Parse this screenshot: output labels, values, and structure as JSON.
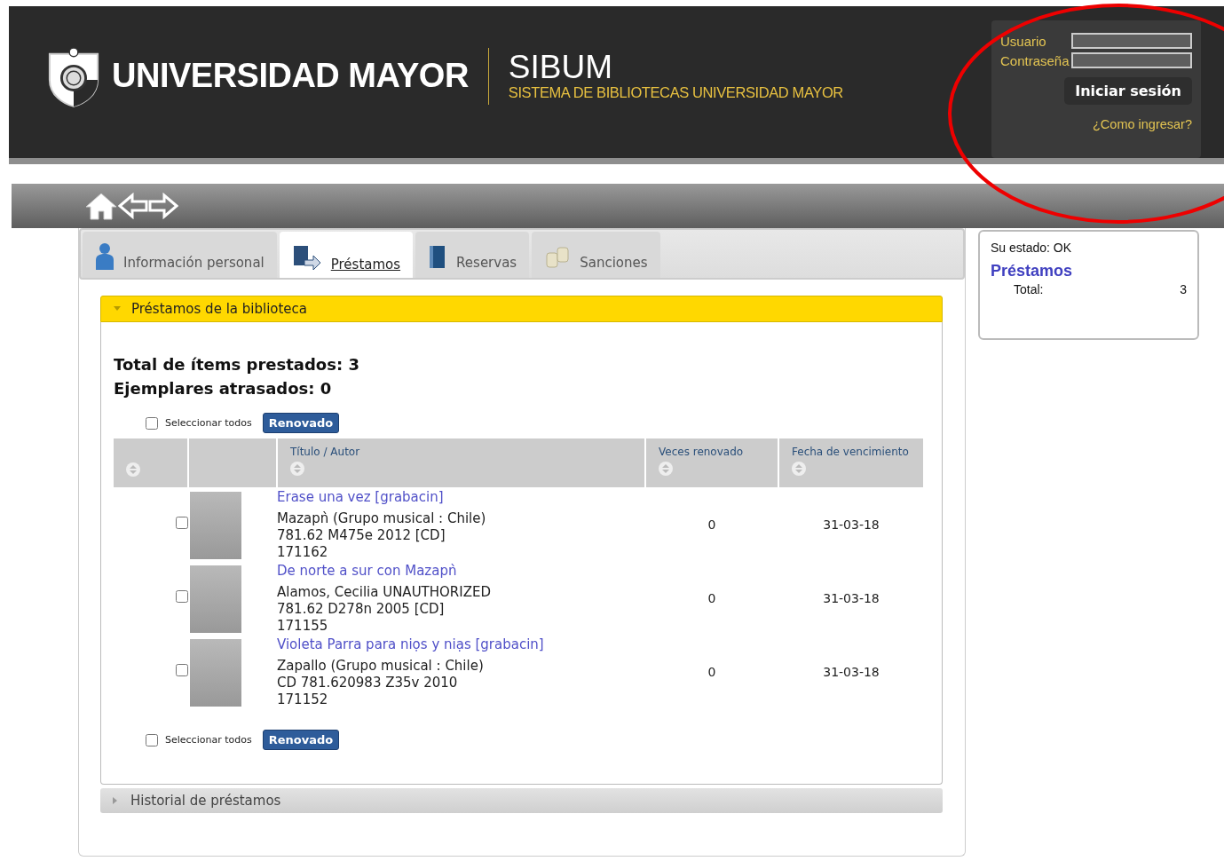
{
  "header": {
    "brand": "UNIVERSIDAD MAYOR",
    "app_title": "SIBUM",
    "app_subtitle": "SISTEMA DE BIBLIOTECAS UNIVERSIDAD MAYOR"
  },
  "login": {
    "user_label": "Usuario",
    "password_label": "Contraseña",
    "button": "Iniciar sesión",
    "help_link": "¿Como ingresar?"
  },
  "tabs": [
    {
      "label": "Información personal",
      "kind": "person",
      "selected": false
    },
    {
      "label": "Préstamos",
      "kind": "loan",
      "selected": true
    },
    {
      "label": "Reservas",
      "kind": "book",
      "selected": false
    },
    {
      "label": "Sanciones",
      "kind": "coins",
      "selected": false
    }
  ],
  "loans_section": {
    "title": "Préstamos de la biblioteca",
    "expanded": true,
    "total": "Total de ítems prestados: 3",
    "overdue": "Ejemplares atrasados: 0",
    "select_all": "Seleccionar todos",
    "select_all_checked": false,
    "renew_button": "Renovado"
  },
  "table": {
    "columns": [
      "Título / Autor",
      "Veces renovado",
      "Fecha de vencimiento"
    ],
    "rows": [
      {
        "checked": false,
        "title": "Erase una vez [grabacin]",
        "author": "Mazapǹ (Grupo musical : Chile)",
        "call_number": "781.62 M475e 2012 [CD]",
        "barcode": "171162",
        "renewals": "0",
        "due": "31-03-18"
      },
      {
        "checked": false,
        "title": "De norte a sur con Mazapǹ",
        "author": "Alamos, Cecilia UNAUTHORIZED",
        "call_number": "781.62 D278n 2005 [CD]",
        "barcode": "171155",
        "renewals": "0",
        "due": "31-03-18"
      },
      {
        "checked": false,
        "title": "Violeta Parra para niọs y niạs [grabacin]",
        "author": "Zapallo (Grupo musical : Chile)",
        "call_number": "CD 781.620983 Z35v 2010",
        "barcode": "171152",
        "renewals": "0",
        "due": "31-03-18"
      }
    ]
  },
  "bottom_actions": {
    "select_all": "Seleccionar todos",
    "select_all_checked": false,
    "renew_button": "Renovado"
  },
  "history_section": {
    "title": "Historial de préstamos",
    "expanded": false
  },
  "status_box": {
    "status": "Su estado: OK",
    "heading": "Préstamos",
    "total_label": "Total:",
    "total_value": "3"
  }
}
